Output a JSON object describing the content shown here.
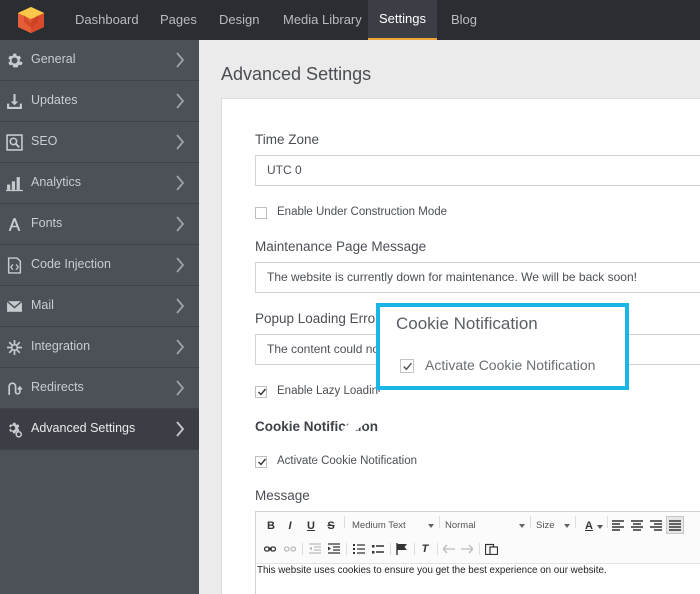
{
  "nav": {
    "items": [
      {
        "label": "Dashboard"
      },
      {
        "label": "Pages"
      },
      {
        "label": "Design"
      },
      {
        "label": "Media Library"
      },
      {
        "label": "Settings",
        "active": true
      },
      {
        "label": "Blog"
      }
    ]
  },
  "sidebar": {
    "items": [
      {
        "label": "General",
        "icon": "gear-icon"
      },
      {
        "label": "Updates",
        "icon": "download-icon"
      },
      {
        "label": "SEO",
        "icon": "search-icon"
      },
      {
        "label": "Analytics",
        "icon": "bar-chart-icon"
      },
      {
        "label": "Fonts",
        "icon": "font-icon"
      },
      {
        "label": "Code Injection",
        "icon": "code-file-icon"
      },
      {
        "label": "Mail",
        "icon": "envelope-icon"
      },
      {
        "label": "Integration",
        "icon": "integration-icon"
      },
      {
        "label": "Redirects",
        "icon": "redirect-icon"
      },
      {
        "label": "Advanced Settings",
        "icon": "advanced-gear-icon",
        "active": true
      }
    ]
  },
  "main": {
    "title": "Advanced Settings",
    "timezone": {
      "label": "Time Zone",
      "value": "UTC 0"
    },
    "construction": {
      "label": "Enable Under Construction Mode",
      "checked": false
    },
    "maintenance": {
      "label": "Maintenance Page Message",
      "value": "The website is currently down for maintenance. We will be back soon!"
    },
    "popup": {
      "label": "Popup Loading Error",
      "value": "The content could not be loaded."
    },
    "lazy": {
      "label": "Enable Lazy Loading",
      "checked": true
    },
    "cookie_section": "Cookie Notification",
    "cookie": {
      "label": "Activate Cookie Notification",
      "checked": true
    },
    "message": {
      "label": "Message",
      "body": "This website uses cookies to ensure you get the best experience on our website."
    }
  },
  "editor_toolbar": {
    "bold": "B",
    "italic": "I",
    "underline": "U",
    "strike": "S",
    "paragraph_style": "Medium Text",
    "format": "Normal",
    "size": "Size",
    "font_color": "A",
    "clear_format": "T"
  },
  "callout": {
    "title": "Cookie Notification",
    "checkbox_label": "Activate Cookie Notification",
    "checked": true
  },
  "colors": {
    "accent": "#19b6e6",
    "nav_bg": "#2a2d31",
    "sidebar_bg": "#4c5057",
    "active_underline": "#f0a23b"
  }
}
